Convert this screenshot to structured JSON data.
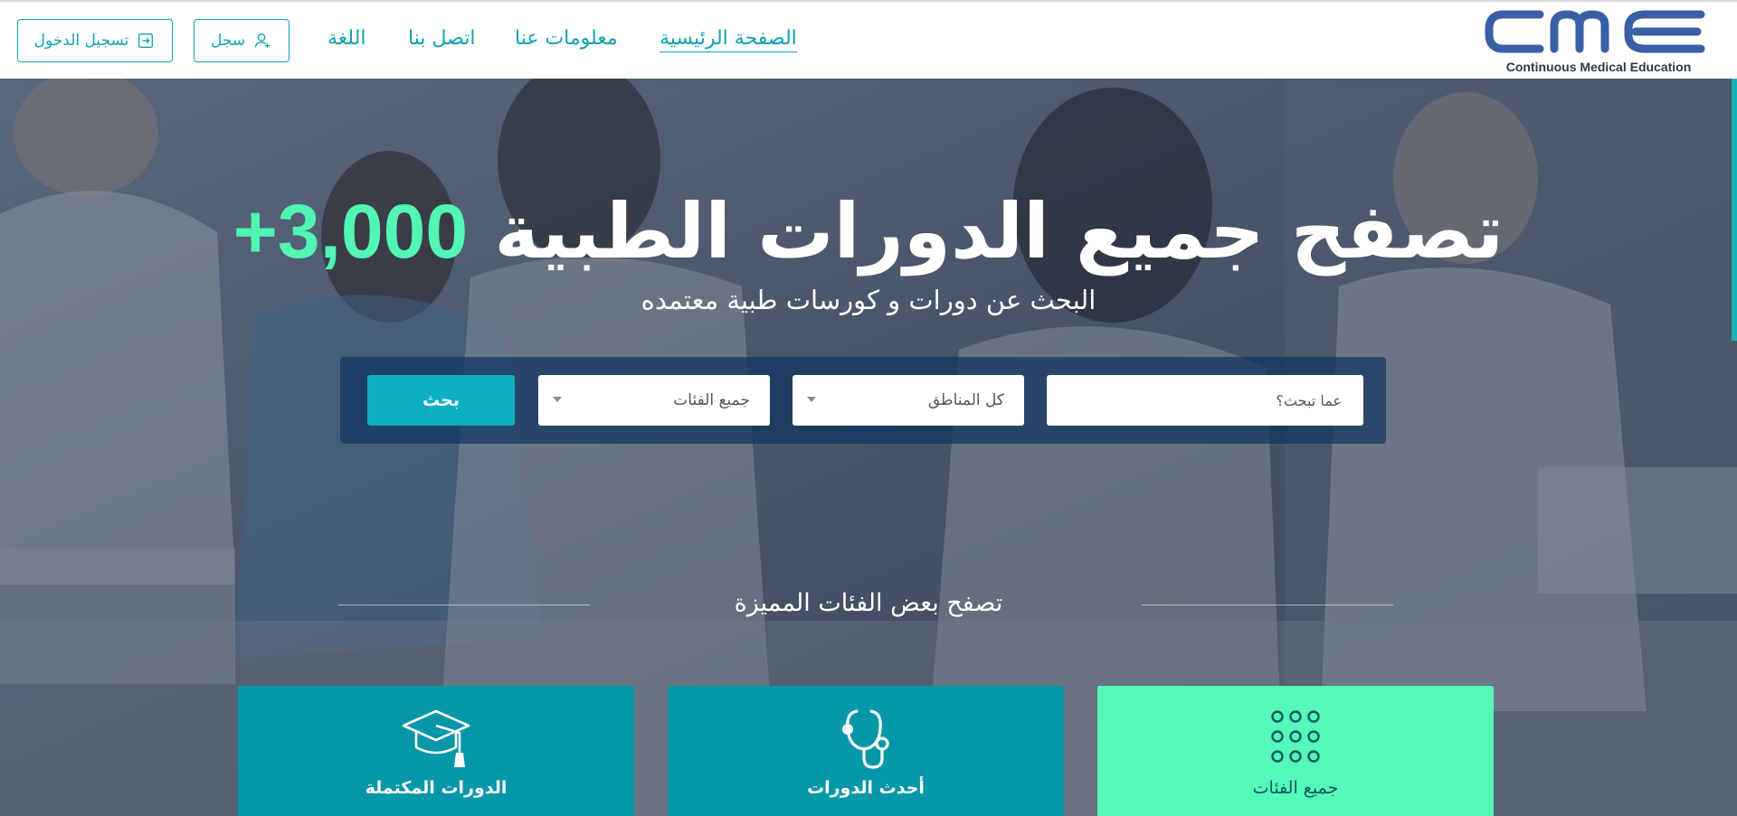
{
  "brand": {
    "logo_text": "CME",
    "tagline": "Continuous Medical Education",
    "logo_color": "#3a5fa6"
  },
  "nav": {
    "items": [
      {
        "label": "الصفحة الرئيسية",
        "active": true
      },
      {
        "label": "معلومات عنا",
        "active": false
      },
      {
        "label": "اتصل بنا",
        "active": false
      },
      {
        "label": "اللغة",
        "active": false
      }
    ],
    "register_label": "سجل",
    "login_label": "تسجيل الدخول"
  },
  "hero": {
    "count": "+3,000",
    "title": "تصفح جميع الدورات الطبية",
    "subtitle": "البحث عن دورات و كورسات طبية معتمده"
  },
  "search": {
    "keyword_placeholder": "عما تبحث؟",
    "region_selected": "كل المناطق",
    "category_selected": "جميع الفئات",
    "button_label": "بحث"
  },
  "featured": {
    "heading": "تصفح بعض الفئات المميزة",
    "cards": [
      {
        "label": "جميع الفئات",
        "icon": "grid-dots-icon"
      },
      {
        "label": "أحدث الدورات",
        "icon": "stethoscope-icon"
      },
      {
        "label": "الدورات المكتملة",
        "icon": "graduation-cap-icon"
      }
    ]
  },
  "colors": {
    "primary": "#0fa3b1",
    "accent": "#52f5b4",
    "search_panel": "#103460",
    "card_teal": "#0697a8",
    "card_mint": "#54f8b8"
  }
}
